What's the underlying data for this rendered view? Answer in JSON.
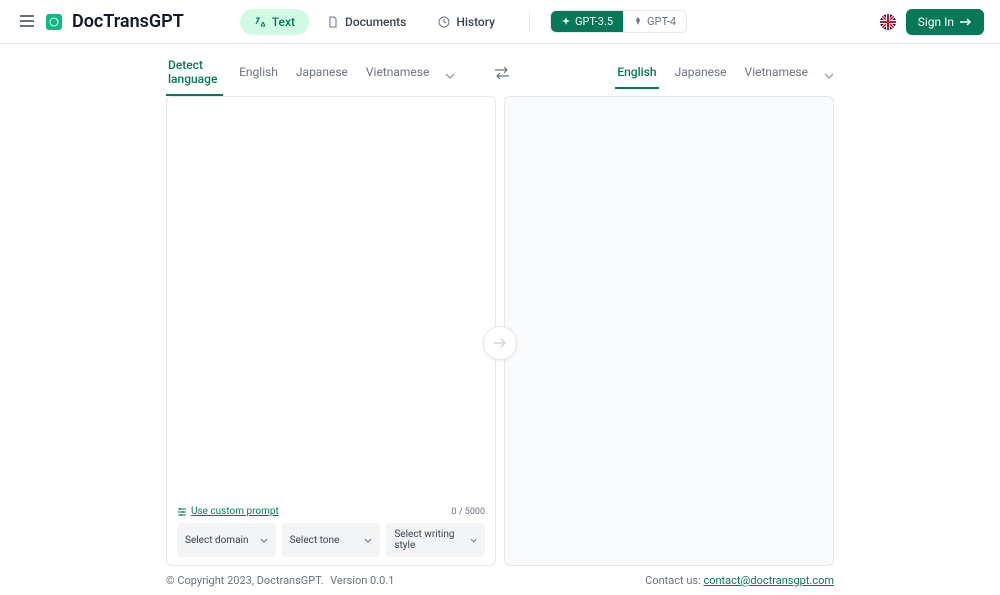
{
  "header": {
    "app_title": "DocTransGPT",
    "nav": {
      "text": "Text",
      "documents": "Documents",
      "history": "History"
    },
    "gpt": {
      "gpt35": "GPT-3.5",
      "gpt4": "GPT-4"
    },
    "signin": "Sign In"
  },
  "lang_source": {
    "detect": "Detect language",
    "english": "English",
    "japanese": "Japanese",
    "vietnamese": "Vietnamese"
  },
  "lang_target": {
    "english": "English",
    "japanese": "Japanese",
    "vietnamese": "Vietnamese"
  },
  "input": {
    "custom_prompt": "Use custom prompt",
    "char_count": "0 / 5000",
    "select_domain": "Select domain",
    "select_tone": "Select tone",
    "select_style": "Select writing style"
  },
  "footer": {
    "copyright": "© Copyright 2023, DoctransGPT.",
    "version": "Version 0.0.1",
    "contact_label": "Contact us: ",
    "contact_email": "contact@doctransgpt.com"
  }
}
